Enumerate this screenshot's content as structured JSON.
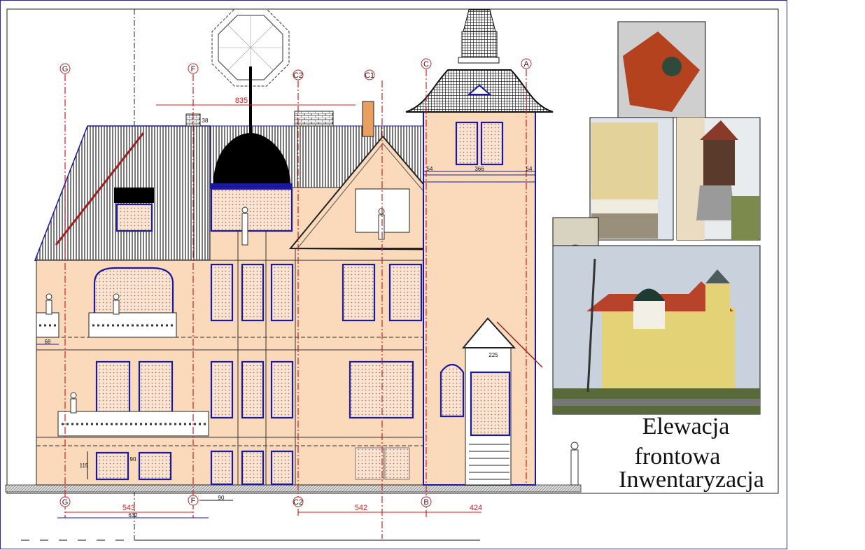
{
  "title": {
    "line1": "Elewacja",
    "line2": "frontowa",
    "line3": "Inwentaryzacja"
  },
  "axes_top": {
    "G": "G",
    "F": "F",
    "C2": "C2",
    "C1": "C1",
    "C": "C",
    "A": "A"
  },
  "axes_bottom": {
    "G": "G",
    "F": "F",
    "C2": "C2",
    "B": "B"
  },
  "dimensions": {
    "roof_width": "835",
    "chimney_height": "38",
    "tower_left": "54",
    "tower_mid": "366",
    "tower_right": "54",
    "balcony_left": "68",
    "plinth_height": "115",
    "plinth_small": "90",
    "entrance": "225",
    "g_f": "543",
    "g_f_total": "632",
    "small_span": "90",
    "c2_mid": "542",
    "b_right": "424"
  },
  "colors": {
    "facade": "#fbd9bb",
    "outline": "#1a1aa0",
    "axis": "#d02020"
  }
}
